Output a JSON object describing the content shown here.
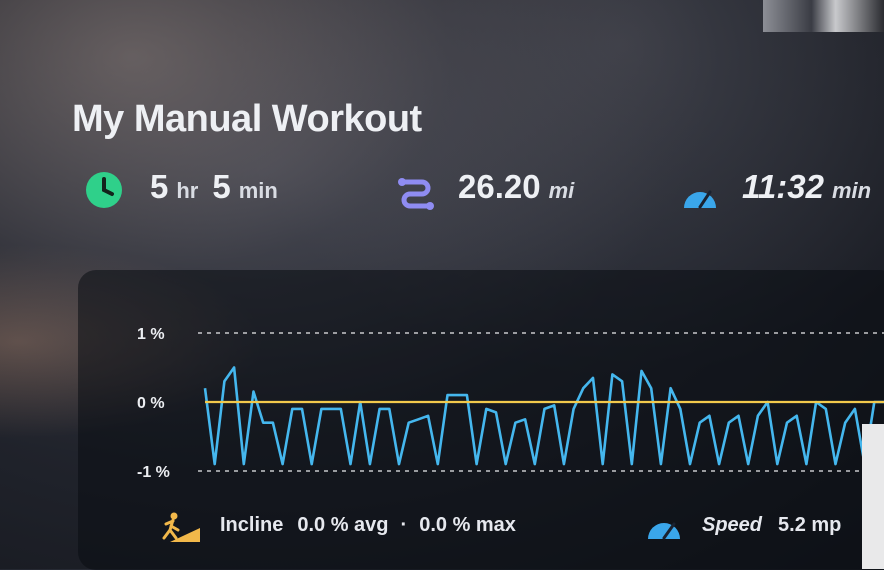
{
  "workout": {
    "title": "My Manual Workout",
    "duration": {
      "hours": "5",
      "hours_unit": "hr",
      "minutes": "5",
      "minutes_unit": "min"
    },
    "distance": {
      "value": "26.20",
      "unit": "mi"
    },
    "pace": {
      "value": "11:32",
      "unit": "min"
    }
  },
  "icons": {
    "duration": "clock-icon",
    "distance": "route-icon",
    "pace": "speedometer-icon",
    "incline": "incline-walker-icon"
  },
  "colors": {
    "clock": "#2fd08a",
    "route": "#8f8cf2",
    "speedometer": "#3aa6ea",
    "incline_line": "#45b7ee",
    "speed_line": "#f2c94c",
    "incline_icon": "#f2b84a"
  },
  "legend": {
    "incline_label": "Incline",
    "incline_avg": "0.0 % avg",
    "separator": "·",
    "incline_max": "0.0 % max",
    "speed_label": "Speed",
    "speed_value": "5.2 mp"
  },
  "chart_data": {
    "type": "line",
    "y_tick_labels": [
      "1 %",
      "0 %",
      "-1 %"
    ],
    "ylim": [
      -1,
      1
    ],
    "grid": "dashed at 1 % and -1 %",
    "series": [
      {
        "name": "Incline",
        "values": [
          0.2,
          -0.9,
          0.3,
          0.5,
          -0.9,
          0.15,
          -0.3,
          -0.3,
          -0.9,
          -0.1,
          -0.1,
          -0.9,
          -0.1,
          -0.1,
          -0.1,
          -0.9,
          0.0,
          -0.9,
          -0.1,
          -0.1,
          -0.9,
          -0.3,
          -0.25,
          -0.2,
          -0.9,
          0.1,
          0.1,
          0.1,
          -0.9,
          -0.1,
          -0.15,
          -0.9,
          -0.3,
          -0.25,
          -0.9,
          -0.1,
          -0.05,
          -0.9,
          -0.1,
          0.2,
          0.35,
          -0.9,
          0.4,
          0.3,
          -0.9,
          0.45,
          0.2,
          -0.9,
          0.2,
          -0.1,
          -0.9,
          -0.3,
          -0.2,
          -0.9,
          -0.3,
          -0.2,
          -0.9,
          -0.2,
          0.0,
          -0.9,
          -0.3,
          -0.2,
          -0.9,
          0.0,
          -0.1,
          -0.9,
          -0.3,
          -0.1,
          -0.9,
          0.0,
          0.0
        ]
      },
      {
        "name": "Speed",
        "values": [
          0.0,
          0.0
        ]
      }
    ]
  }
}
